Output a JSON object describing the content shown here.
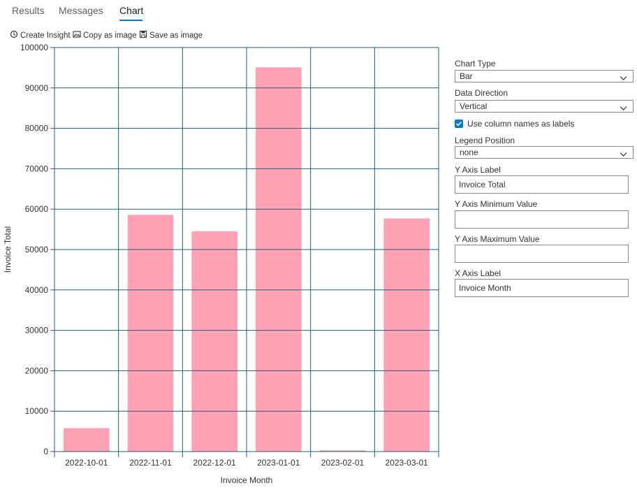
{
  "tabs": [
    {
      "label": "Results"
    },
    {
      "label": "Messages"
    },
    {
      "label": "Chart"
    }
  ],
  "active_tab": "Chart",
  "toolbar": {
    "create_insight": "Create Insight",
    "copy_as_image": "Copy as image",
    "save_as_image": "Save as image"
  },
  "chart_data": {
    "type": "bar",
    "categories": [
      "2022-10-01",
      "2022-11-01",
      "2022-12-01",
      "2023-01-01",
      "2023-02-01",
      "2023-03-01"
    ],
    "values": [
      5800,
      58600,
      54500,
      95100,
      300,
      57700
    ],
    "xlabel": "Invoice Month",
    "ylabel": "Invoice Total",
    "ylim": [
      0,
      100000
    ],
    "yticks": [
      "100000",
      "90000",
      "80000",
      "70000",
      "60000",
      "50000",
      "40000",
      "30000",
      "20000",
      "10000",
      "0"
    ],
    "grid": true,
    "bar_color": "#ffa1b5",
    "grid_color": "#1f5b7a"
  },
  "panel": {
    "chart_type_label": "Chart Type",
    "chart_type_value": "Bar",
    "data_direction_label": "Data Direction",
    "data_direction_value": "Vertical",
    "use_column_names_label": "Use column names as labels",
    "use_column_names_checked": true,
    "legend_position_label": "Legend Position",
    "legend_position_value": "none",
    "y_axis_label_label": "Y Axis Label",
    "y_axis_label_value": "Invoice Total",
    "y_axis_min_label": "Y Axis Minimum Value",
    "y_axis_min_value": "",
    "y_axis_max_label": "Y Axis Maximum Value",
    "y_axis_max_value": "",
    "x_axis_label_label": "X Axis Label",
    "x_axis_label_value": "Invoice Month"
  },
  "colors": {
    "accent": "#0078d4"
  }
}
